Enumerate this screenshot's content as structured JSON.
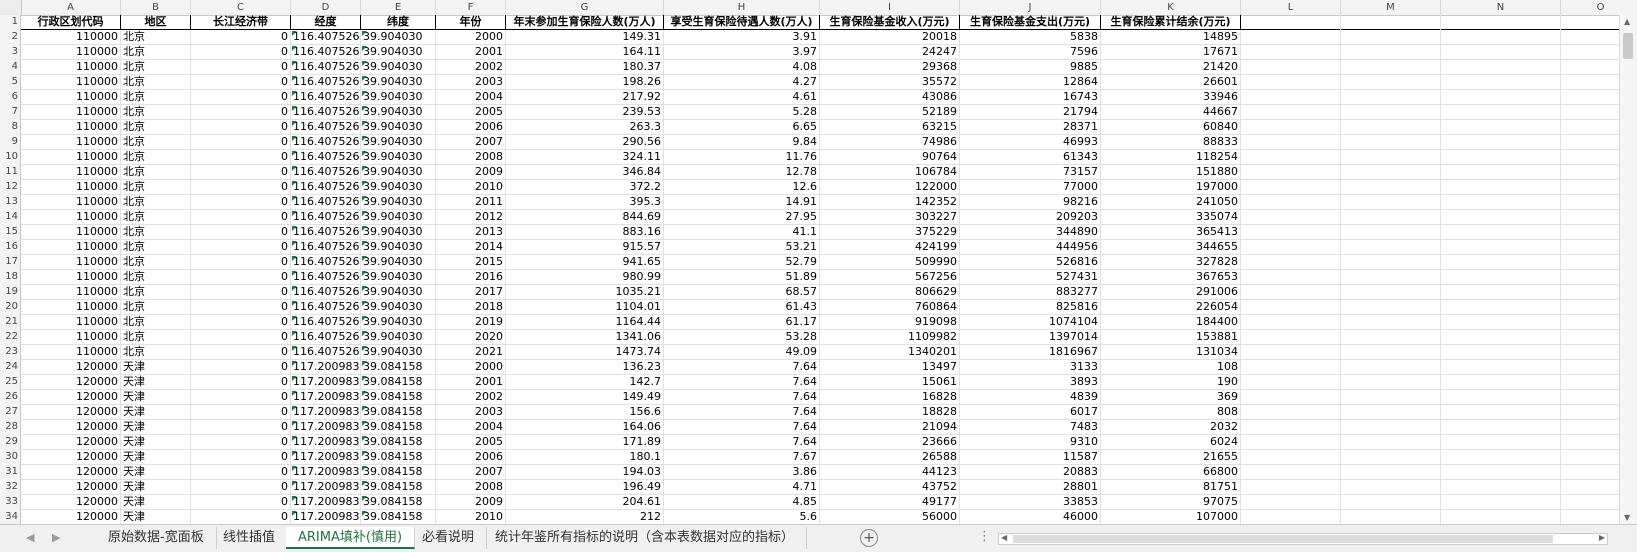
{
  "columns": [
    "A",
    "B",
    "C",
    "D",
    "E",
    "F",
    "G",
    "H",
    "I",
    "J",
    "K",
    "L",
    "M",
    "N",
    "O"
  ],
  "header_row": {
    "num": "1",
    "cells": [
      "行政区划代码",
      "地区",
      "长江经济带",
      "经度",
      "纬度",
      "年份",
      "年末参加生育保险人数(万人)",
      "享受生育保险待遇人数(万人)",
      "生育保险基金收入(万元)",
      "生育保险基金支出(万元)",
      "生育保险累计结余(万元)"
    ]
  },
  "rows": [
    [
      "2",
      "110000",
      "北京",
      "0",
      "116.407526",
      "39.904030",
      "2000",
      "149.31",
      "3.91",
      "20018",
      "5838",
      "14895"
    ],
    [
      "3",
      "110000",
      "北京",
      "0",
      "116.407526",
      "39.904030",
      "2001",
      "164.11",
      "3.97",
      "24247",
      "7596",
      "17671"
    ],
    [
      "4",
      "110000",
      "北京",
      "0",
      "116.407526",
      "39.904030",
      "2002",
      "180.37",
      "4.08",
      "29368",
      "9885",
      "21420"
    ],
    [
      "5",
      "110000",
      "北京",
      "0",
      "116.407526",
      "39.904030",
      "2003",
      "198.26",
      "4.27",
      "35572",
      "12864",
      "26601"
    ],
    [
      "6",
      "110000",
      "北京",
      "0",
      "116.407526",
      "39.904030",
      "2004",
      "217.92",
      "4.61",
      "43086",
      "16743",
      "33946"
    ],
    [
      "7",
      "110000",
      "北京",
      "0",
      "116.407526",
      "39.904030",
      "2005",
      "239.53",
      "5.28",
      "52189",
      "21794",
      "44667"
    ],
    [
      "8",
      "110000",
      "北京",
      "0",
      "116.407526",
      "39.904030",
      "2006",
      "263.3",
      "6.65",
      "63215",
      "28371",
      "60840"
    ],
    [
      "9",
      "110000",
      "北京",
      "0",
      "116.407526",
      "39.904030",
      "2007",
      "290.56",
      "9.84",
      "74986",
      "46993",
      "88833"
    ],
    [
      "10",
      "110000",
      "北京",
      "0",
      "116.407526",
      "39.904030",
      "2008",
      "324.11",
      "11.76",
      "90764",
      "61343",
      "118254"
    ],
    [
      "11",
      "110000",
      "北京",
      "0",
      "116.407526",
      "39.904030",
      "2009",
      "346.84",
      "12.78",
      "106784",
      "73157",
      "151880"
    ],
    [
      "12",
      "110000",
      "北京",
      "0",
      "116.407526",
      "39.904030",
      "2010",
      "372.2",
      "12.6",
      "122000",
      "77000",
      "197000"
    ],
    [
      "13",
      "110000",
      "北京",
      "0",
      "116.407526",
      "39.904030",
      "2011",
      "395.3",
      "14.91",
      "142352",
      "98216",
      "241050"
    ],
    [
      "14",
      "110000",
      "北京",
      "0",
      "116.407526",
      "39.904030",
      "2012",
      "844.69",
      "27.95",
      "303227",
      "209203",
      "335074"
    ],
    [
      "15",
      "110000",
      "北京",
      "0",
      "116.407526",
      "39.904030",
      "2013",
      "883.16",
      "41.1",
      "375229",
      "344890",
      "365413"
    ],
    [
      "16",
      "110000",
      "北京",
      "0",
      "116.407526",
      "39.904030",
      "2014",
      "915.57",
      "53.21",
      "424199",
      "444956",
      "344655"
    ],
    [
      "17",
      "110000",
      "北京",
      "0",
      "116.407526",
      "39.904030",
      "2015",
      "941.65",
      "52.79",
      "509990",
      "526816",
      "327828"
    ],
    [
      "18",
      "110000",
      "北京",
      "0",
      "116.407526",
      "39.904030",
      "2016",
      "980.99",
      "51.89",
      "567256",
      "527431",
      "367653"
    ],
    [
      "19",
      "110000",
      "北京",
      "0",
      "116.407526",
      "39.904030",
      "2017",
      "1035.21",
      "68.57",
      "806629",
      "883277",
      "291006"
    ],
    [
      "20",
      "110000",
      "北京",
      "0",
      "116.407526",
      "39.904030",
      "2018",
      "1104.01",
      "61.43",
      "760864",
      "825816",
      "226054"
    ],
    [
      "21",
      "110000",
      "北京",
      "0",
      "116.407526",
      "39.904030",
      "2019",
      "1164.44",
      "61.17",
      "919098",
      "1074104",
      "184400"
    ],
    [
      "22",
      "110000",
      "北京",
      "0",
      "116.407526",
      "39.904030",
      "2020",
      "1341.06",
      "53.28",
      "1109982",
      "1397014",
      "153881"
    ],
    [
      "23",
      "110000",
      "北京",
      "0",
      "116.407526",
      "39.904030",
      "2021",
      "1473.74",
      "49.09",
      "1340201",
      "1816967",
      "131034"
    ],
    [
      "24",
      "120000",
      "天津",
      "0",
      "117.200983",
      "39.084158",
      "2000",
      "136.23",
      "7.64",
      "13497",
      "3133",
      "108"
    ],
    [
      "25",
      "120000",
      "天津",
      "0",
      "117.200983",
      "39.084158",
      "2001",
      "142.7",
      "7.64",
      "15061",
      "3893",
      "190"
    ],
    [
      "26",
      "120000",
      "天津",
      "0",
      "117.200983",
      "39.084158",
      "2002",
      "149.49",
      "7.64",
      "16828",
      "4839",
      "369"
    ],
    [
      "27",
      "120000",
      "天津",
      "0",
      "117.200983",
      "39.084158",
      "2003",
      "156.6",
      "7.64",
      "18828",
      "6017",
      "808"
    ],
    [
      "28",
      "120000",
      "天津",
      "0",
      "117.200983",
      "39.084158",
      "2004",
      "164.06",
      "7.64",
      "21094",
      "7483",
      "2032"
    ],
    [
      "29",
      "120000",
      "天津",
      "0",
      "117.200983",
      "39.084158",
      "2005",
      "171.89",
      "7.64",
      "23666",
      "9310",
      "6024"
    ],
    [
      "30",
      "120000",
      "天津",
      "0",
      "117.200983",
      "39.084158",
      "2006",
      "180.1",
      "7.67",
      "26588",
      "11587",
      "21655"
    ],
    [
      "31",
      "120000",
      "天津",
      "0",
      "117.200983",
      "39.084158",
      "2007",
      "194.03",
      "3.86",
      "44123",
      "20883",
      "66800"
    ],
    [
      "32",
      "120000",
      "天津",
      "0",
      "117.200983",
      "39.084158",
      "2008",
      "196.49",
      "4.71",
      "43752",
      "28801",
      "81751"
    ],
    [
      "33",
      "120000",
      "天津",
      "0",
      "117.200983",
      "39.084158",
      "2009",
      "204.61",
      "4.85",
      "49177",
      "33853",
      "97075"
    ],
    [
      "34",
      "120000",
      "天津",
      "0",
      "117.200983",
      "39.084158",
      "2010",
      "212",
      "5.6",
      "56000",
      "46000",
      "107000"
    ]
  ],
  "sheet_tabs": [
    {
      "label": "原始数据-宽面板",
      "active": false
    },
    {
      "label": "线性插值",
      "active": false
    },
    {
      "label": "ARIMA填补(慎用)",
      "active": true
    },
    {
      "label": "必看说明",
      "active": false
    },
    {
      "label": "统计年鉴所有指标的说明（含本表数据对应的指标）",
      "active": false
    }
  ],
  "tab_nav": {
    "prev": "◀",
    "next": "▶"
  },
  "add_sheet": "+",
  "more": "⋮",
  "colors": {
    "active_tab": "#217346",
    "green_triangle": "#1a7f37"
  }
}
